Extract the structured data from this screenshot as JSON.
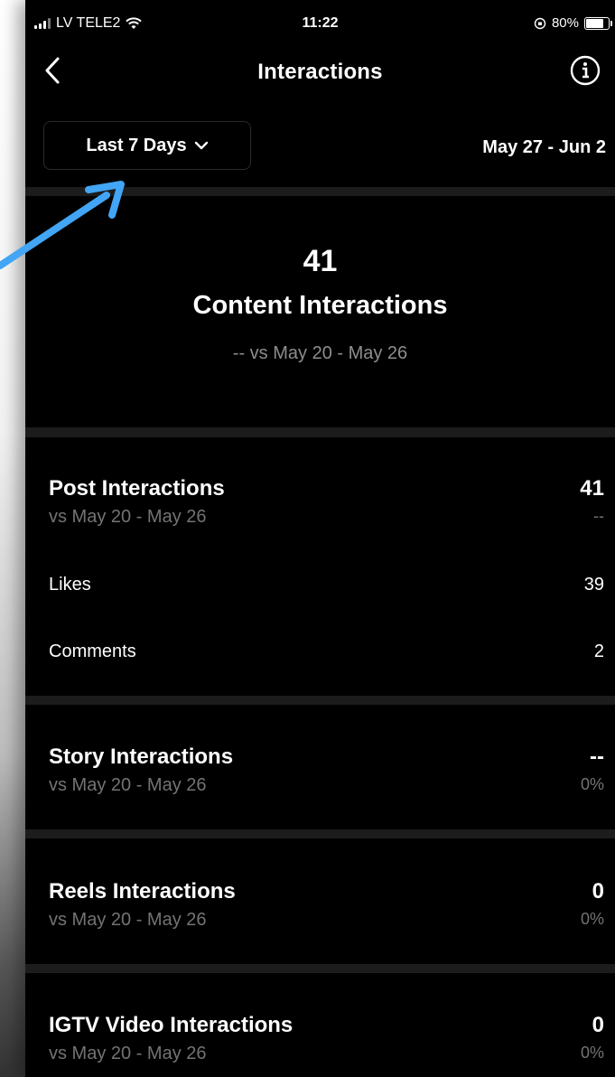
{
  "status_bar": {
    "carrier": "LV TELE2",
    "time": "11:22",
    "battery": "80%",
    "battery_level": 0.8
  },
  "nav": {
    "title": "Interactions",
    "back_icon": "chevron-left-icon",
    "info_icon": "info-icon"
  },
  "filter": {
    "range_label": "Last 7 Days",
    "date_range": "May 27 - Jun 2"
  },
  "summary": {
    "value": "41",
    "label": "Content Interactions",
    "compare": "-- vs May 20 - May 26"
  },
  "sections": {
    "post": {
      "title": "Post Interactions",
      "sub": "vs May 20 - May 26",
      "value": "41",
      "delta": "--",
      "items": [
        {
          "label": "Likes",
          "value": "39"
        },
        {
          "label": "Comments",
          "value": "2"
        }
      ]
    },
    "story": {
      "title": "Story Interactions",
      "sub": "vs May 20 - May 26",
      "value": "--",
      "delta": "0%"
    },
    "reels": {
      "title": "Reels Interactions",
      "sub": "vs May 20 - May 26",
      "value": "0",
      "delta": "0%"
    },
    "igtv": {
      "title": "IGTV Video Interactions",
      "sub": "vs May 20 - May 26",
      "value": "0",
      "delta": "0%"
    }
  },
  "colors": {
    "background": "#000000",
    "divider": "#1c1c1c",
    "secondary_text": "#737373",
    "annotation_arrow": "#42a5f5"
  }
}
